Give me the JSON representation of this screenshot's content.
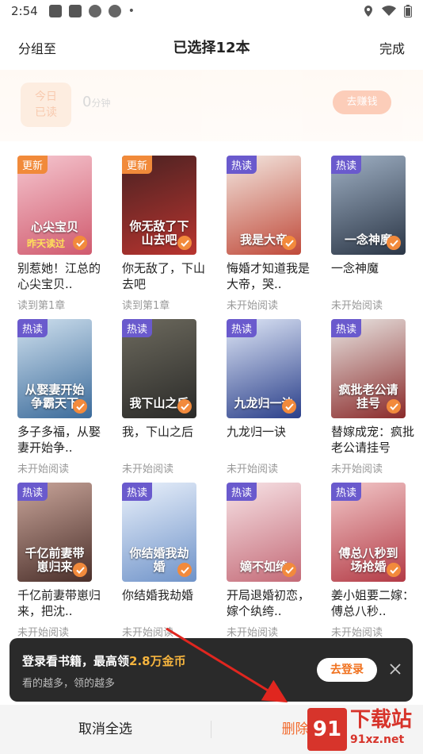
{
  "status_bar": {
    "time": "2:54",
    "dot": "•"
  },
  "header": {
    "left": "分组至",
    "title": "已选择12本",
    "right": "完成"
  },
  "reading": {
    "today_label": "今日\n已读",
    "today_line1": "今日",
    "today_line2": "已读",
    "minutes_value": "0",
    "minutes_unit": "分钟",
    "earn_label": "去赚钱"
  },
  "books": [
    {
      "tag": "更新",
      "tag_type": "new",
      "cover_text": "心尖宝贝",
      "cover_sub": "昨天读过",
      "title": "别惹她！江总的心尖宝贝..",
      "status": "读到第1章",
      "colors": [
        "#f5c6cf",
        "#d05a6e"
      ]
    },
    {
      "tag": "更新",
      "tag_type": "new",
      "cover_text": "你无敌了下山去吧",
      "title": "你无敌了，下山去吧",
      "status": "读到第1章",
      "colors": [
        "#4a2222",
        "#b8342f"
      ]
    },
    {
      "tag": "热读",
      "tag_type": "hot",
      "cover_text": "我是大帝",
      "title": "悔婚才知道我是大帝，哭..",
      "status": "未开始阅读",
      "colors": [
        "#f3e7e0",
        "#c04a3a"
      ]
    },
    {
      "tag": "热读",
      "tag_type": "hot",
      "cover_text": "一念神魔",
      "title": "一念神魔",
      "status": "未开始阅读",
      "colors": [
        "#9fb0c4",
        "#2b3646"
      ]
    },
    {
      "tag": "热读",
      "tag_type": "hot",
      "cover_text": "从娶妻开始争霸天下",
      "title": "多子多福，从娶妻开始争..",
      "status": "未开始阅读",
      "colors": [
        "#cfe0ee",
        "#3a6a9a"
      ]
    },
    {
      "tag": "热读",
      "tag_type": "hot",
      "cover_text": "我下山之后",
      "title": "我，下山之后",
      "status": "未开始阅读",
      "colors": [
        "#6d6a5e",
        "#2a2a28"
      ]
    },
    {
      "tag": "热读",
      "tag_type": "hot",
      "cover_text": "九龙归一诀",
      "title": "九龙归一诀",
      "status": "未开始阅读",
      "colors": [
        "#dfe7f7",
        "#2a3f8a"
      ]
    },
    {
      "tag": "热读",
      "tag_type": "hot",
      "cover_text": "疯批老公请挂号",
      "title": "替嫁成宠：疯批老公请挂号",
      "status": "未开始阅读",
      "colors": [
        "#e9e6e3",
        "#8a2a2a"
      ]
    },
    {
      "tag": "热读",
      "tag_type": "hot",
      "cover_text": "千亿前妻带崽归来",
      "title": "千亿前妻带崽归来，把沈..",
      "status": "未开始阅读",
      "colors": [
        "#c9a59a",
        "#4a2f2a"
      ]
    },
    {
      "tag": "热读",
      "tag_type": "hot",
      "cover_text": "你结婚我劫婚",
      "title": "你结婚我劫婚",
      "status": "未开始阅读",
      "colors": [
        "#eaf1fb",
        "#6f93c9"
      ]
    },
    {
      "tag": "热读",
      "tag_type": "hot",
      "cover_text": "嫡不如绮",
      "title": "开局退婚初恋，嫁个纨绔..",
      "status": "未开始阅读",
      "colors": [
        "#f7e3e6",
        "#c46a77"
      ]
    },
    {
      "tag": "热读",
      "tag_type": "hot",
      "cover_text": "傅总八秒到场抢婚",
      "title": "姜小姐要二嫁：傅总八秒..",
      "status": "未开始阅读",
      "colors": [
        "#f2c8c9",
        "#b33a45"
      ]
    }
  ],
  "toast": {
    "text_prefix": "登录看书籍，最高领",
    "text_highlight": "2.8万金币",
    "subtext": "看的越多，领的越多",
    "login_label": "去登录"
  },
  "bottom_bar": {
    "cancel_label": "取消全选",
    "delete_label": "删除（12）"
  },
  "watermark": {
    "logo": "91",
    "text": "下载站",
    "url": "91xz.net"
  },
  "colors": {
    "accent": "#f28a3c",
    "delete": "#f26a2c",
    "toast_bg": "#2a2a2a",
    "highlight": "#f5b43e"
  }
}
